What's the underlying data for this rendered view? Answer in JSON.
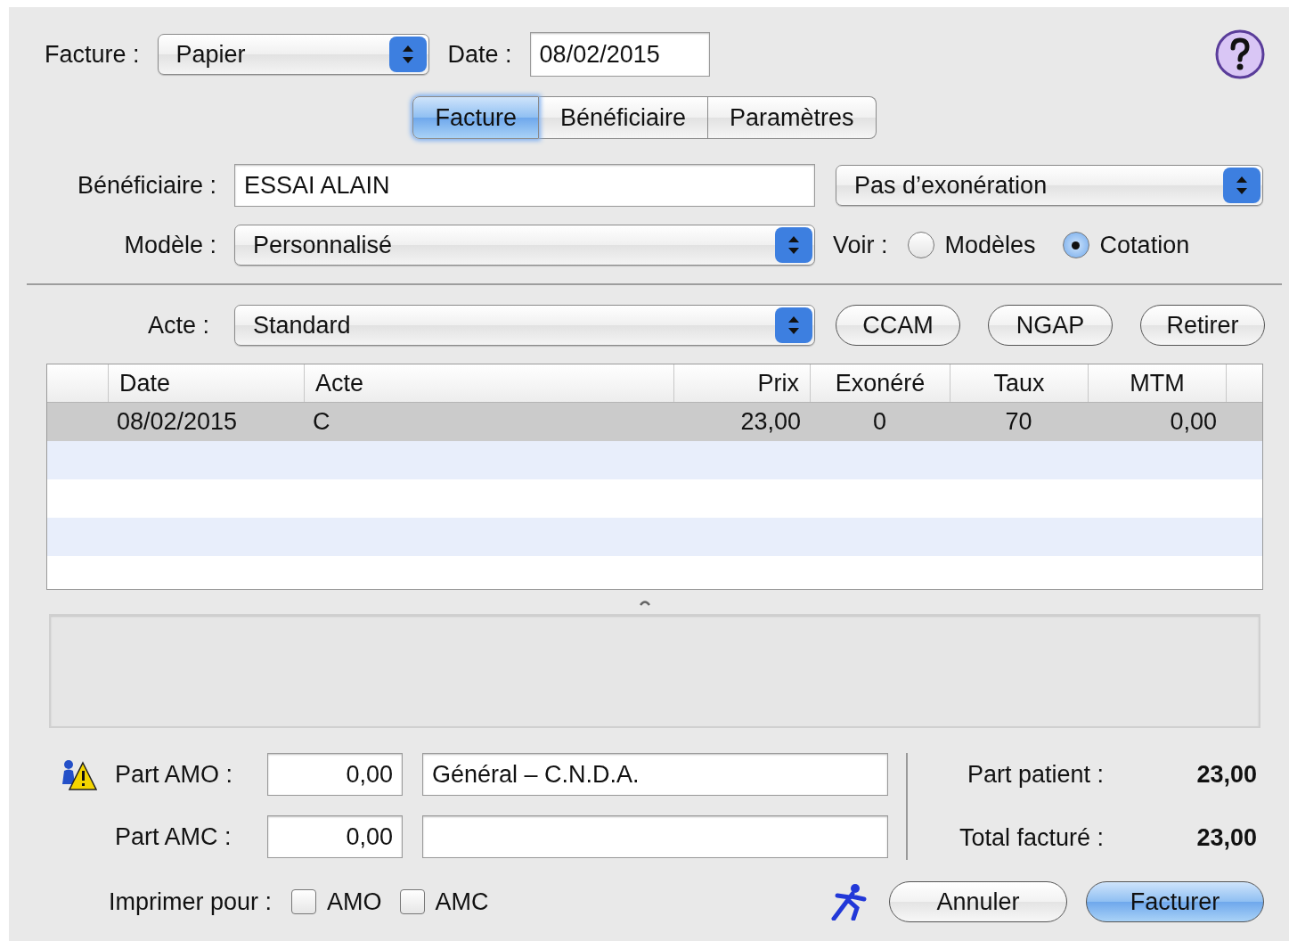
{
  "header": {
    "facture_label": "Facture :",
    "facture_value": "Papier",
    "date_label": "Date :",
    "date_value": "08/02/2015"
  },
  "tabs": [
    {
      "label": "Facture",
      "selected": true
    },
    {
      "label": "Bénéficiaire",
      "selected": false
    },
    {
      "label": "Paramètres",
      "selected": false
    }
  ],
  "form": {
    "beneficiaire_label": "Bénéficiaire :",
    "beneficiaire_value": "ESSAI ALAIN",
    "exoneration_value": "Pas d’exonération",
    "modele_label": "Modèle :",
    "modele_value": "Personnalisé",
    "voir_label": "Voir :",
    "voir_options": [
      {
        "label": "Modèles",
        "selected": false
      },
      {
        "label": "Cotation",
        "selected": true
      }
    ]
  },
  "acte": {
    "label": "Acte :",
    "value": "Standard",
    "buttons": [
      "CCAM",
      "NGAP",
      "Retirer"
    ]
  },
  "table": {
    "columns": [
      "Date",
      "Acte",
      "Prix",
      "Exonéré",
      "Taux",
      "MTM"
    ],
    "rows": [
      {
        "cells": [
          "08/02/2015",
          "C",
          "23,00",
          "0",
          "70",
          "0,00"
        ],
        "selected": true
      }
    ]
  },
  "amounts": [
    {
      "label": "Part AMO :",
      "value": "0,00",
      "regime": "Général – C.N.D.A.",
      "warning": true
    },
    {
      "label": "Part AMC :",
      "value": "0,00",
      "warning": false
    }
  ],
  "summary": [
    {
      "label": "Part patient :",
      "value": "23,00"
    },
    {
      "label": "Total facturé :",
      "value": "23,00"
    }
  ],
  "print": {
    "label": "Imprimer pour :",
    "options": [
      {
        "label": "AMO",
        "checked": false
      },
      {
        "label": "AMC",
        "checked": false
      }
    ]
  },
  "buttons": [
    {
      "label": "Annuler",
      "default": false
    },
    {
      "label": "Facturer",
      "default": true
    }
  ]
}
